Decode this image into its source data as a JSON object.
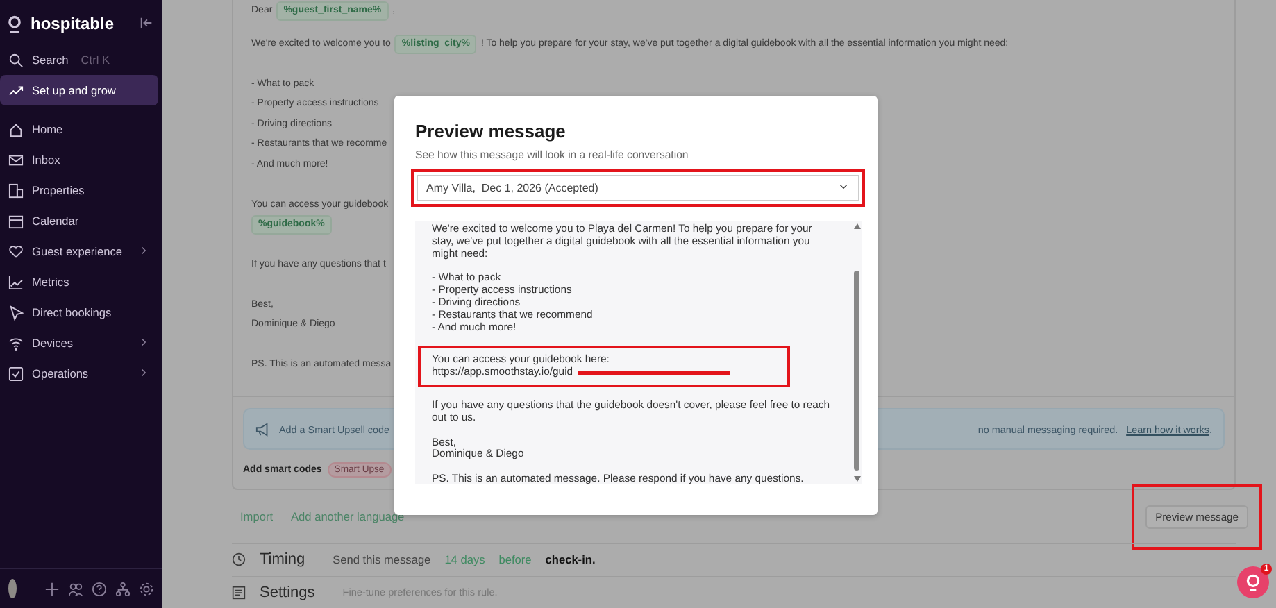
{
  "sidebar": {
    "brand": "hospitable",
    "search": {
      "label": "Search",
      "shortcut": "Ctrl K"
    },
    "items": [
      {
        "kind": "feature",
        "label": "Set up and grow",
        "selected": true,
        "has_submenu": false
      },
      {
        "kind": "nav",
        "label": "Home",
        "selected": false,
        "has_submenu": false
      },
      {
        "kind": "nav",
        "label": "Inbox",
        "selected": false,
        "has_submenu": false
      },
      {
        "kind": "nav",
        "label": "Properties",
        "selected": false,
        "has_submenu": false
      },
      {
        "kind": "nav",
        "label": "Calendar",
        "selected": false,
        "has_submenu": false
      },
      {
        "kind": "nav",
        "label": "Guest experience",
        "selected": false,
        "has_submenu": true
      },
      {
        "kind": "nav",
        "label": "Metrics",
        "selected": false,
        "has_submenu": false
      },
      {
        "kind": "nav",
        "label": "Direct bookings",
        "selected": false,
        "has_submenu": false
      },
      {
        "kind": "nav",
        "label": "Devices",
        "selected": false,
        "has_submenu": true
      },
      {
        "kind": "nav",
        "label": "Operations",
        "selected": false,
        "has_submenu": true
      }
    ]
  },
  "editor": {
    "paragraphs": [
      [
        [
          {
            "kind": "text",
            "text": "Dear"
          },
          {
            "kind": "chip",
            "text": "%guest_first_name%"
          },
          {
            "kind": "text",
            "text": ","
          }
        ]
      ],
      [
        [
          {
            "kind": "text",
            "text": "We're excited to welcome you to"
          },
          {
            "kind": "chip",
            "text": "%listing_city%"
          },
          {
            "kind": "text",
            "text": "! To help you prepare for your stay, we've put together a digital guidebook with all the essential information you might need:"
          }
        ]
      ],
      [
        [
          {
            "kind": "text",
            "text": "- What to pack"
          }
        ],
        [
          {
            "kind": "text",
            "text": "- Property access instructions"
          }
        ],
        [
          {
            "kind": "text",
            "text": "- Driving directions"
          }
        ],
        [
          {
            "kind": "text",
            "text": "- Restaurants that we recomme"
          }
        ],
        [
          {
            "kind": "text",
            "text": "- And much more!"
          }
        ]
      ],
      [
        [
          {
            "kind": "text",
            "text": "You can access your guidebook"
          }
        ],
        [
          {
            "kind": "chip",
            "text": "%guidebook%"
          }
        ]
      ],
      [
        [
          {
            "kind": "text",
            "text": "If you have any questions that t"
          }
        ]
      ],
      [
        [
          {
            "kind": "text",
            "text": "Best,"
          }
        ],
        [
          {
            "kind": "text",
            "text": "Dominique & Diego"
          }
        ]
      ],
      [
        [
          {
            "kind": "text",
            "text": "PS. This is an automated messa"
          }
        ]
      ]
    ],
    "upsell_banner": {
      "text": "Add a Smart Upsell code",
      "tail": "no manual messaging required.",
      "link": "Learn how it works",
      "after_link": "."
    },
    "smart_codes": {
      "label": "Add smart codes",
      "chips": [
        "Smart Upse"
      ]
    }
  },
  "actions": {
    "links": [
      "Import",
      "Add another language"
    ],
    "preview_button": "Preview message"
  },
  "timing": {
    "title": "Timing",
    "segments": [
      {
        "kind": "muted",
        "text": "Send this message"
      },
      {
        "kind": "accent",
        "text": "14 days"
      },
      {
        "kind": "accent",
        "text": "before"
      },
      {
        "kind": "strong",
        "text": "check-in."
      }
    ]
  },
  "settings": {
    "title": "Settings",
    "description": "Fine-tune preferences for this rule."
  },
  "modal": {
    "title": "Preview message",
    "subtitle": "See how this message will look in a real-life conversation",
    "reservation_select": "Amy Villa,  Dec 1, 2026 (Accepted)",
    "preview_paragraphs": [
      {
        "highlighted": false,
        "lines": [
          {
            "text": "We're excited to welcome you to Playa del Carmen! To help you prepare for your stay, we've put together a digital guidebook with all the essential information you might need:",
            "redacted": false
          }
        ]
      },
      {
        "highlighted": false,
        "lines": [
          {
            "text": "- What to pack",
            "redacted": false
          },
          {
            "text": "- Property access instructions",
            "redacted": false
          },
          {
            "text": "- Driving directions",
            "redacted": false
          },
          {
            "text": "- Restaurants that we recommend",
            "redacted": false
          },
          {
            "text": "- And much more!",
            "redacted": false
          }
        ]
      },
      {
        "highlighted": true,
        "lines": [
          {
            "text": "You can access your guidebook here:",
            "redacted": false
          },
          {
            "text": "https://app.smoothstay.io/guid",
            "redacted": true
          }
        ]
      },
      {
        "highlighted": false,
        "lines": [
          {
            "text": "If you have any questions that the guidebook doesn't cover, please feel free to reach out to us.",
            "redacted": false
          }
        ]
      },
      {
        "highlighted": false,
        "lines": [
          {
            "text": "Best,",
            "redacted": false
          },
          {
            "text": "Dominique & Diego",
            "redacted": false
          }
        ]
      },
      {
        "highlighted": false,
        "lines": [
          {
            "text": "PS. This is an automated message. Please respond if you have any questions.",
            "redacted": false
          }
        ]
      }
    ]
  },
  "help_bubble": {
    "badge": "1"
  }
}
